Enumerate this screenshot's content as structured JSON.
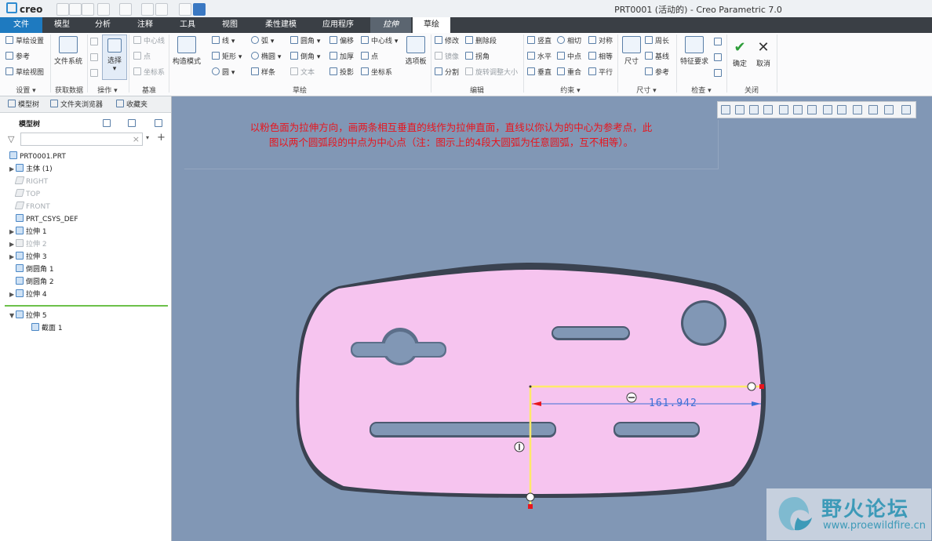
{
  "window": {
    "logo": "creo",
    "title": "PRT0001 (活动的) - Creo Parametric 7.0"
  },
  "tabs": [
    "文件",
    "模型",
    "分析",
    "注释",
    "工具",
    "视图",
    "柔性建模",
    "应用程序",
    "拉伸",
    "草绘"
  ],
  "ribbon": {
    "setup": {
      "sketch_setup": "草绘设置",
      "references": "参考",
      "sketch_view": "草绘视图",
      "label": "设置 ▾"
    },
    "get_data": {
      "file_system": "文件系统",
      "label": "获取数据"
    },
    "operations": {
      "select": "选择",
      "label": "操作 ▾"
    },
    "datum": {
      "centerline": "中心线",
      "point": "点",
      "csys": "坐标系",
      "label": "基准"
    },
    "sketch": {
      "construction_mode": "构造模式",
      "line": "线 ▾",
      "arc": "弧 ▾",
      "fillet": "圆角 ▾",
      "offset": "偏移",
      "centerline": "中心线 ▾",
      "rectangle": "矩形 ▾",
      "ellipse": "椭圆 ▾",
      "chamfer": "倒角 ▾",
      "thicken": "加厚",
      "point": "点",
      "circle": "圆 ▾",
      "spline": "样条",
      "text": "文本",
      "project": "投影",
      "csys": "坐标系",
      "palette": "选项板",
      "label": "草绘"
    },
    "edit": {
      "modify": "修改",
      "delete_segment": "删除段",
      "mirror": "镜像",
      "corner": "拐角",
      "divide": "分割",
      "rotate_resize": "旋转调整大小",
      "label": "编辑"
    },
    "constrain": {
      "vertical": "竖直",
      "tangent": "相切",
      "symmetric": "对称",
      "horizontal": "水平",
      "midpoint": "中点",
      "equal": "相等",
      "perpendicular": "垂直",
      "coincident": "重合",
      "parallel": "平行",
      "label": "约束 ▾"
    },
    "dimension": {
      "dimension": "尺寸",
      "perimeter": "周长",
      "baseline": "基线",
      "reference": "参考",
      "label": "尺寸 ▾"
    },
    "inspect": {
      "feature_requirements": "特征要求",
      "label": "检查 ▾"
    },
    "close": {
      "ok": "确定",
      "cancel": "取消",
      "label": "关闭"
    }
  },
  "sidebar": {
    "tabs": [
      "模型树",
      "文件夹浏览器",
      "收藏夹"
    ],
    "header": "模型树",
    "filter_close": "×",
    "add": "+",
    "tree": [
      {
        "label": "PRT0001.PRT",
        "dim": false
      },
      {
        "label": "主体 (1)",
        "dim": false
      },
      {
        "label": "RIGHT",
        "dim": true
      },
      {
        "label": "TOP",
        "dim": true
      },
      {
        "label": "FRONT",
        "dim": true
      },
      {
        "label": "PRT_CSYS_DEF",
        "dim": false
      },
      {
        "label": "拉伸 1",
        "dim": false
      },
      {
        "label": "拉伸 2",
        "dim": true
      },
      {
        "label": "拉伸 3",
        "dim": false
      },
      {
        "label": "倒圆角 1",
        "dim": false
      },
      {
        "label": "倒圆角 2",
        "dim": false
      },
      {
        "label": "拉伸 4",
        "dim": false
      }
    ],
    "active": [
      {
        "label": "拉伸 5"
      },
      {
        "label": "截面 1"
      }
    ]
  },
  "canvas": {
    "note_line1": "以粉色面为拉伸方向，画两条相互垂直的线作为拉伸直面，直线以你认为的中心为参考点，此",
    "note_line2": "图以两个圆弧段的中点为中心点（注：图示上的4段大圆弧为任意圆弧，互不相等）。",
    "dimension_value": "161.942",
    "colors": {
      "background": "#8197b5",
      "face": "#f6c4ef",
      "sketch_line": "#ffe96a",
      "note": "#e8151d"
    }
  },
  "watermark": {
    "text": "野火论坛",
    "url": "www.proewildfire.cn"
  }
}
